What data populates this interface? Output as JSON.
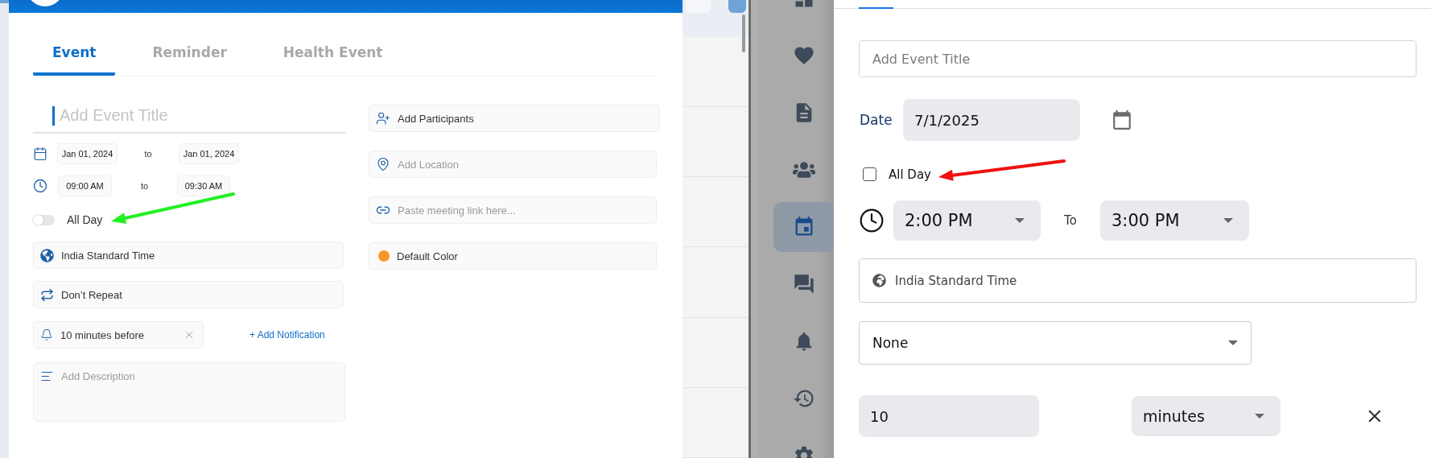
{
  "left_app": {
    "tabs": [
      {
        "label": "Event",
        "selected": true
      },
      {
        "label": "Reminder",
        "selected": false
      },
      {
        "label": "Health Event",
        "selected": false
      }
    ],
    "title_field": {
      "placeholder": "Add Event Title"
    },
    "date_row": {
      "start": "Jan 01, 2024",
      "separator": "to",
      "end": "Jan 01, 2024"
    },
    "time_row": {
      "start": "09:00 AM",
      "separator": "to",
      "end": "09:30 AM"
    },
    "all_day": {
      "label": "All Day",
      "on": false
    },
    "timezone": {
      "value": "India Standard Time"
    },
    "repeat": {
      "value": "Don’t Repeat"
    },
    "notification": {
      "value": "10 minutes before"
    },
    "add_notification": {
      "label": "+ Add Notification"
    },
    "description": {
      "placeholder": "Add Description"
    },
    "participants": {
      "label": "Add Participants"
    },
    "location": {
      "placeholder": "Add Location"
    },
    "meeting_link": {
      "placeholder": "Paste meeting link here..."
    },
    "event_color": {
      "label": "Default Color",
      "color": "#f7952c"
    }
  },
  "right_app": {
    "sidebar": {
      "items": [
        {
          "kind": "dashboard",
          "selected": false
        },
        {
          "kind": "health",
          "selected": false
        },
        {
          "kind": "document",
          "selected": false
        },
        {
          "kind": "people",
          "selected": false
        },
        {
          "kind": "calendar",
          "selected": true
        },
        {
          "kind": "chat",
          "selected": false
        },
        {
          "kind": "bell",
          "selected": false
        },
        {
          "kind": "history",
          "selected": false
        },
        {
          "kind": "settings",
          "selected": false
        }
      ]
    },
    "title_field": {
      "placeholder": "Add Event Title"
    },
    "date": {
      "label": "Date",
      "value": "7/1/2025"
    },
    "all_day": {
      "label": "All Day",
      "checked": false
    },
    "time": {
      "start": "2:00 PM",
      "separator": "To",
      "end": "3:00 PM"
    },
    "timezone": {
      "value": "India Standard Time"
    },
    "repeat": {
      "value": "None"
    },
    "reminder": {
      "amount": "10",
      "unit": "minutes"
    }
  },
  "annotations": [
    {
      "kind": "arrow",
      "color": "#22f022"
    },
    {
      "kind": "arrow",
      "color": "#f01010"
    }
  ]
}
